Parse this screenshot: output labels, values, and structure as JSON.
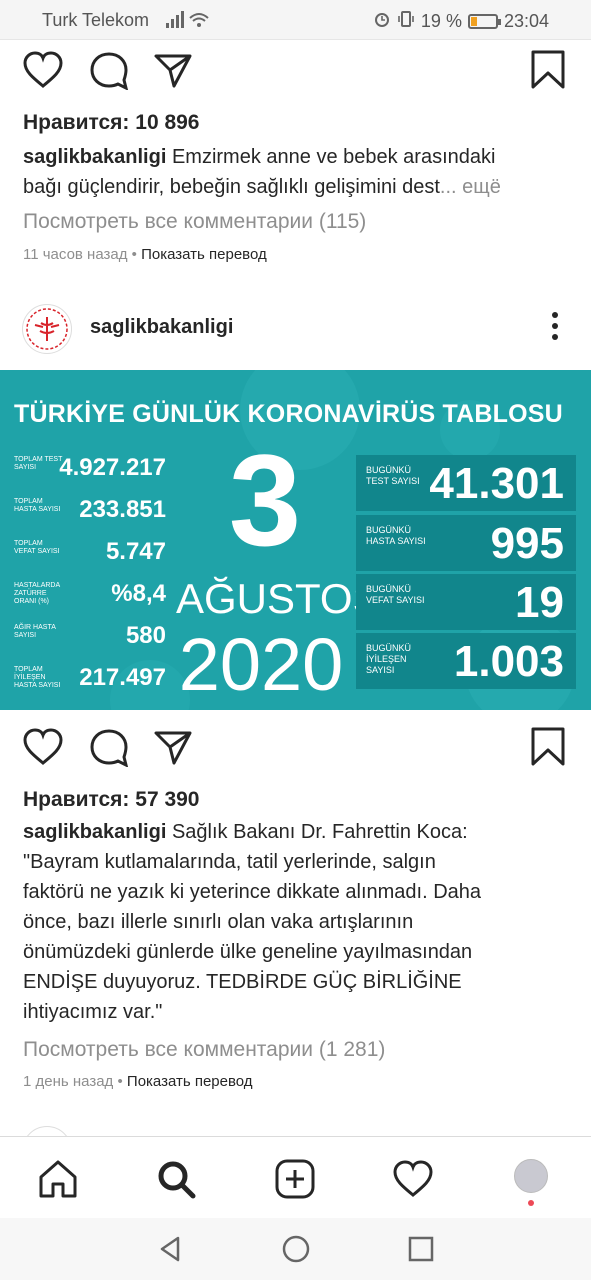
{
  "status_bar": {
    "carrier": "Turk Telekom",
    "battery_percent": "19 %",
    "time": "23:04",
    "icons": [
      "signal-icon",
      "wifi-icon",
      "alarm-icon",
      "vibrate-icon",
      "battery-icon"
    ]
  },
  "post1": {
    "likes": "Нравится: 10 896",
    "username": "saglikbakanligi",
    "caption_line1": "Emzirmek anne ve bebek arasındaki",
    "caption_line2": "bağı güçlendirir, bebeğin sağlıklı gelişimini dest",
    "more": "... ещё",
    "view_comments": "Посмотреть все комментарии (115)",
    "time_ago": "11 часов назад",
    "translate": "Показать перевод"
  },
  "post2": {
    "username": "saglikbakanligi",
    "board": {
      "title": "TÜRKİYE GÜNLÜK KORONAVİRÜS TABLOSU",
      "stats": [
        {
          "label": "TOPLAM TEST SAYISI",
          "value": "4.927.217"
        },
        {
          "label": "TOPLAM HASTA SAYISI",
          "value": "233.851"
        },
        {
          "label": "TOPLAM VEFAT SAYISI",
          "value": "5.747"
        },
        {
          "label": "HASTALARDA ZATÜRRE ORANI (%)",
          "value": "%8,4"
        },
        {
          "label": "AĞIR HASTA SAYISI",
          "value": "580"
        },
        {
          "label": "TOPLAM İYİLEŞEN HASTA SAYISI",
          "value": "217.497"
        }
      ],
      "day": "3",
      "month": "AĞUSTOS",
      "year": "2020",
      "daily": [
        {
          "label": "BUGÜNKÜ TEST SAYISI",
          "value": "41.301"
        },
        {
          "label": "BUGÜNKÜ HASTA SAYISI",
          "value": "995"
        },
        {
          "label": "BUGÜNKÜ VEFAT SAYISI",
          "value": "19"
        },
        {
          "label": "BUGÜNKÜ İYİLEŞEN SAYISI",
          "value": "1.003"
        }
      ]
    },
    "likes": "Нравится: 57 390",
    "caption_lines": [
      "Sağlık Bakanı Dr. Fahrettin Koca:",
      "\"Bayram kutlamalarında, tatil yerlerinde, salgın",
      "faktörü ne yazık ki yeterince dikkate alınmadı. Daha",
      "önce, bazı illerle sınırlı olan vaka artışlarının",
      "önümüzdeki günlerde ülke geneline yayılmasından",
      "ENDİŞE duyuyoruz. TEDBİRDE GÜÇ BİRLİĞİNE",
      "ihtiyacımız var.\""
    ],
    "view_comments": "Посмотреть все комментарии (1 281)",
    "time_ago": "1 день назад",
    "translate": "Показать перевод"
  },
  "tab_bar": {
    "tabs": [
      "home-icon",
      "search-icon",
      "new-post-icon",
      "activity-icon",
      "profile-avatar"
    ],
    "active_tab": "search-icon"
  },
  "nav_bar": [
    "back-icon",
    "home-circle-icon",
    "recents-icon"
  ]
}
